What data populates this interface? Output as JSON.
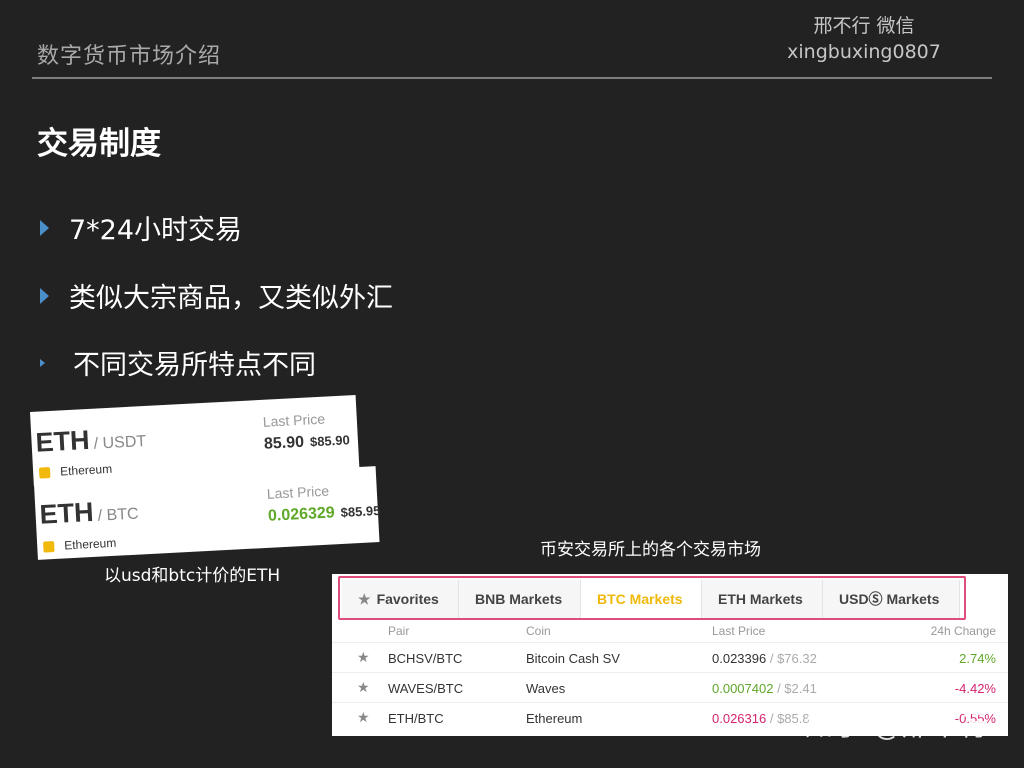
{
  "header": {
    "title": "数字货币市场介绍",
    "author_line1": "邢不行 微信",
    "author_line2": "xingbuxing0807"
  },
  "slide": {
    "title": "交易制度",
    "bullets": [
      "7*24小时交易",
      "类似大宗商品，又类似外汇",
      "不同交易所特点不同"
    ]
  },
  "cards": [
    {
      "base": "ETH",
      "quote": "/ USDT",
      "coin": "Ethereum",
      "price_label": "Last Price",
      "price": "85.90",
      "usd": "$85.90",
      "price_color": "#333333"
    },
    {
      "base": "ETH",
      "quote": "/ BTC",
      "coin": "Ethereum",
      "price_label": "Last Price",
      "price": "0.026329",
      "usd": "$85.95",
      "price_color": "#5fa82a"
    }
  ],
  "captions": {
    "left": "以usd和btc计价的ETH",
    "right": "币安交易所上的各个交易市场"
  },
  "market": {
    "tabs": [
      "Favorites",
      "BNB Markets",
      "BTC Markets",
      "ETH Markets",
      "USDⓈ Markets"
    ],
    "active_tab": "BTC Markets",
    "columns": [
      "Pair",
      "Coin",
      "Last Price",
      "24h Change"
    ],
    "rows": [
      {
        "pair": "BCHSV/BTC",
        "coin": "Bitcoin Cash SV",
        "price": "0.023396",
        "usd": " / $76.32",
        "change": "2.74%"
      },
      {
        "pair": "WAVES/BTC",
        "coin": "Waves",
        "price": "0.0007402",
        "usd": " / $2.41",
        "change": "-4.42%"
      },
      {
        "pair": "ETH/BTC",
        "coin": "Ethereum",
        "price": "0.026316",
        "usd": " / $85.8",
        "change": "-0.55%"
      }
    ],
    "colors": {
      "up": "#5fa82a",
      "down": "#d6246f",
      "highlight": "#de4c7a",
      "active": "#f0b90b"
    }
  },
  "watermark": "知乎 @邢不行"
}
